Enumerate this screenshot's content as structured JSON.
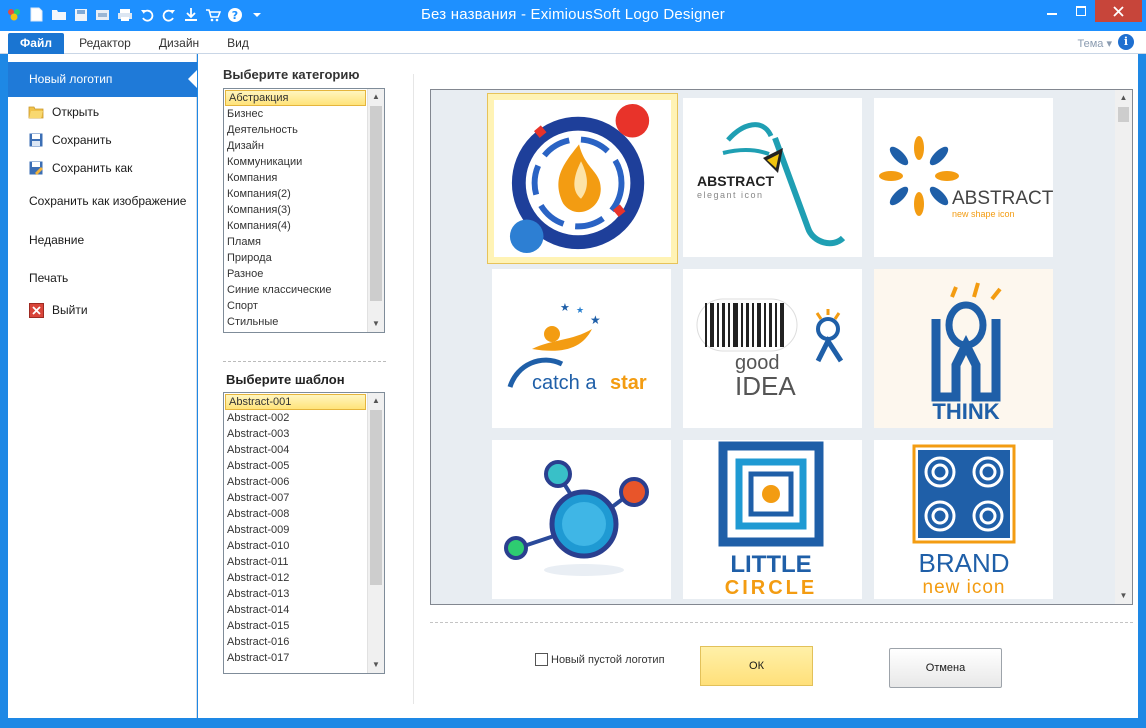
{
  "window": {
    "title": "Без названия - EximiousSoft Logo Designer"
  },
  "ribbon": {
    "tabs": [
      "Файл",
      "Редактор",
      "Дизайн",
      "Вид"
    ],
    "theme_label": "Тема",
    "info_glyph": "i"
  },
  "menu": {
    "new_logo": "Новый логотип",
    "open": "Открыть",
    "save": "Сохранить",
    "save_as": "Сохранить как",
    "save_as_image": "Сохранить как изображение",
    "recent": "Недавние",
    "print": "Печать",
    "exit": "Выйти"
  },
  "category": {
    "label": "Выберите категорию",
    "selected": "Абстракция",
    "items": [
      "Абстракция",
      "Бизнес",
      "Деятельность",
      "Дизайн",
      "Коммуникации",
      "Компания",
      "Компания(2)",
      "Компания(3)",
      "Компания(4)",
      "Пламя",
      "Природа",
      "Разное",
      "Синие классические",
      "Спорт",
      "Стильные"
    ]
  },
  "template": {
    "label": "Выберите шаблон",
    "selected": "Abstract-001",
    "items": [
      "Abstract-001",
      "Abstract-002",
      "Abstract-003",
      "Abstract-004",
      "Abstract-005",
      "Abstract-006",
      "Abstract-007",
      "Abstract-008",
      "Abstract-009",
      "Abstract-010",
      "Abstract-011",
      "Abstract-012",
      "Abstract-013",
      "Abstract-014",
      "Abstract-015",
      "Abstract-016",
      "Abstract-017"
    ]
  },
  "gallery": {
    "logos": [
      {
        "line1": "",
        "line2": ""
      },
      {
        "line1": "ABSTRACT",
        "line2": "elegant icon"
      },
      {
        "line1": "ABSTRACT",
        "line2": "new shape icon"
      },
      {
        "line1": "catch a",
        "line2": "star"
      },
      {
        "line1": "good",
        "line2": "IDEA"
      },
      {
        "line1": "THINK",
        "line2": ""
      },
      {
        "line1": "",
        "line2": ""
      },
      {
        "line1": "LITTLE",
        "line2": "CIRCLE"
      },
      {
        "line1": "BRAND",
        "line2": "new icon"
      }
    ]
  },
  "footer": {
    "blank_logo_label": "Новый пустой логотип",
    "ok_label": "ОК",
    "cancel_label": "Отмена"
  },
  "colors": {
    "titlebar": "#1e90ff",
    "accent": "#1f7ad8",
    "close_button": "#c7453a",
    "selection": "#ffe37a"
  }
}
